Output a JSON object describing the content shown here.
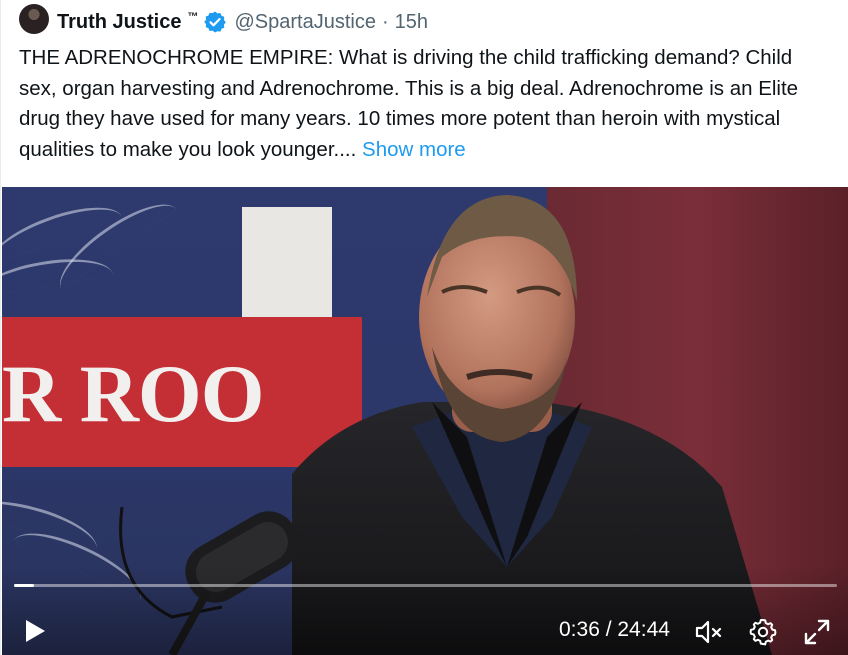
{
  "tweet": {
    "display_name": "Truth Justice",
    "tm": "™",
    "handle": "@SpartaJustice",
    "separator": "·",
    "time": "15h",
    "text": "THE ADRENOCHROME EMPIRE: What is driving the child trafficking demand? Child sex, organ harvesting and Adrenochrome. This is a big deal. Adrenochrome is an Elite drug they have used for many years. 10 times more potent than heroin with mystical qualities to make you look younger....",
    "show_more": "Show more"
  },
  "video": {
    "backdrop_text": "R ROO",
    "time_display": "0:36 / 24:44",
    "progress_fraction": 0.024,
    "icons": [
      "play-icon",
      "volume-muted-icon",
      "settings-gear-icon",
      "fullscreen-expand-icon"
    ]
  },
  "colors": {
    "link": "#1d9bf0",
    "verified": "#1d9bf0",
    "text": "#0f1419",
    "secondary": "#536471"
  }
}
